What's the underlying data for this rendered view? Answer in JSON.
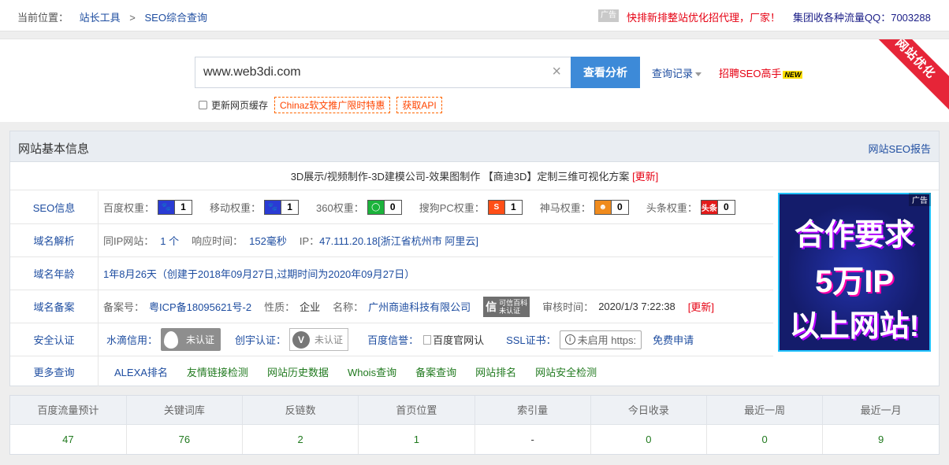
{
  "topbar": {
    "location_label": "当前位置：",
    "crumb1": "站长工具",
    "crumb_sep": ">",
    "crumb2": "SEO综合查询",
    "ad_tag": "广告",
    "ad_text": "快排新排整站优化招代理，厂家！",
    "qq_text": "集团收各种流量QQ：7003288"
  },
  "search": {
    "value": "www.web3di.com",
    "clear_icon": "×",
    "button": "查看分析",
    "history": "查询记录",
    "hire": "招聘SEO高手",
    "new_badge": "NEW",
    "refresh_cache": "更新网页缓存",
    "promo1": "Chinaz软文推广限时特惠",
    "promo2": "获取API",
    "corner_text": "网站优化"
  },
  "info": {
    "title": "网站基本信息",
    "report_link": "网站SEO报告",
    "site_title": "3D展示/视频制作-3D建模公司-效果图制作 【商迪3D】定制三维可视化方案",
    "update": "[更新]",
    "seo": {
      "label": "SEO信息",
      "items": [
        {
          "name": "百度权重：",
          "icon": "paw-icon",
          "icon_text": "🐾",
          "value": "1",
          "color": "#2a3bd4"
        },
        {
          "name": "移动权重：",
          "icon": "paw-icon",
          "icon_text": "🐾",
          "value": "1",
          "color": "#2a3bd4"
        },
        {
          "name": "360权重：",
          "icon": "360-icon",
          "icon_text": "◯",
          "value": "0",
          "color": "#1bb33b"
        },
        {
          "name": "搜狗PC权重：",
          "icon": "sogou-icon",
          "icon_text": "S",
          "value": "1",
          "color": "#ff4e17"
        },
        {
          "name": "神马权重：",
          "icon": "shenma-icon",
          "icon_text": "☻",
          "value": "0",
          "color": "#f08b1d"
        },
        {
          "name": "头条权重：",
          "icon": "toutiao-icon",
          "icon_text": "头条",
          "value": "0",
          "color": "#e31a1a"
        }
      ]
    },
    "domain": {
      "label": "域名解析",
      "same_ip_label": "同IP网站：",
      "same_ip_value": "1 个",
      "resp_label": "响应时间：",
      "resp_value": "152毫秒",
      "ip_label": "IP：",
      "ip_value": "47.111.20.18[浙江省杭州市 阿里云]"
    },
    "age": {
      "label": "域名年龄",
      "value": "1年8月26天（创建于2018年09月27日,过期时间为2020年09月27日）"
    },
    "beian": {
      "label": "域名备案",
      "no_label": "备案号：",
      "no_value": "粤ICP备18095621号-2",
      "type_label": "性质：",
      "type_value": "企业",
      "name_label": "名称：",
      "name_value": "广州商迪科技有限公司",
      "kx_icon": "信",
      "kx_text1": "可信百科",
      "kx_text2": "未认证",
      "audit_label": "审核时间：",
      "audit_value": "2020/1/3 7:22:38",
      "update": "[更新]"
    },
    "security": {
      "label": "安全认证",
      "sd_label": "水滴信用：",
      "sd_value": "未认证",
      "cy_label": "创宇认证：",
      "cy_icon": "V",
      "cy_value": "未认证",
      "bd_label": "百度信誉：",
      "bd_value": "百度官网认",
      "ssl_label": "SSL证书：",
      "ssl_icon": "i",
      "ssl_value": "未启用 https:",
      "free": "免费申请"
    },
    "more": {
      "label": "更多查询",
      "links": [
        "ALEXA排名",
        "友情链接检测",
        "网站历史数据",
        "Whois查询",
        "备案查询",
        "网站排名",
        "网站安全检测"
      ]
    },
    "ad": {
      "tag": "广告",
      "line1": "合作要求",
      "line2": "5万IP",
      "line3": "以上网站!"
    }
  },
  "stats": {
    "headers": [
      "百度流量预计",
      "关键词库",
      "反链数",
      "首页位置",
      "索引量",
      "今日收录",
      "最近一周",
      "最近一月"
    ],
    "values": [
      "47",
      "76",
      "2",
      "1",
      "-",
      "0",
      "0",
      "9"
    ]
  }
}
